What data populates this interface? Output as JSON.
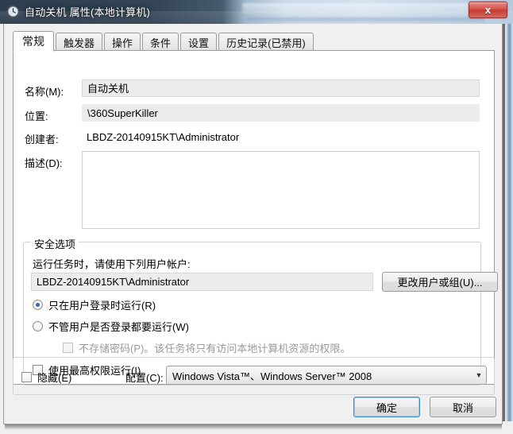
{
  "window": {
    "title": "自动关机 属性(本地计算机)",
    "icon": "task-scheduler-clock-icon",
    "close_label": "x",
    "accent_color": "#2b6fba",
    "close_color": "#c63b32"
  },
  "tabs": [
    {
      "label": "常规",
      "active": true
    },
    {
      "label": "触发器",
      "active": false
    },
    {
      "label": "操作",
      "active": false
    },
    {
      "label": "条件",
      "active": false
    },
    {
      "label": "设置",
      "active": false
    },
    {
      "label": "历史记录(已禁用)",
      "active": false
    }
  ],
  "general": {
    "name_label": "名称(M):",
    "name_value": "自动关机",
    "location_label": "位置:",
    "location_value": "\\360SuperKiller",
    "author_label": "创建者:",
    "author_value": "LBDZ-20140915KT\\Administrator",
    "description_label": "描述(D):",
    "description_value": ""
  },
  "security": {
    "group_title": "安全选项",
    "account_prompt": "运行任务时，请使用下列用户帐户:",
    "account_value": "LBDZ-20140915KT\\Administrator",
    "change_user_button": "更改用户或组(U)...",
    "radio_logged_on": "只在用户登录时运行(R)",
    "radio_logged_on_checked": true,
    "radio_any_user": "不管用户是否登录都要运行(W)",
    "radio_any_user_checked": false,
    "check_no_store_password": "不存储密码(P)。该任务将只有访问本地计算机资源的权限。",
    "check_no_store_password_checked": false,
    "check_no_store_password_disabled": true,
    "check_highest_privileges": "使用最高权限运行(I)",
    "check_highest_privileges_checked": false
  },
  "bottom": {
    "hidden_label": "隐藏(E)",
    "hidden_checked": false,
    "configure_label": "配置(C):",
    "configure_value": "Windows Vista™、Windows Server™ 2008",
    "configure_options": [
      "Windows Vista™、Windows Server™ 2008"
    ]
  },
  "footer": {
    "ok_label": "确定",
    "cancel_label": "取消"
  }
}
